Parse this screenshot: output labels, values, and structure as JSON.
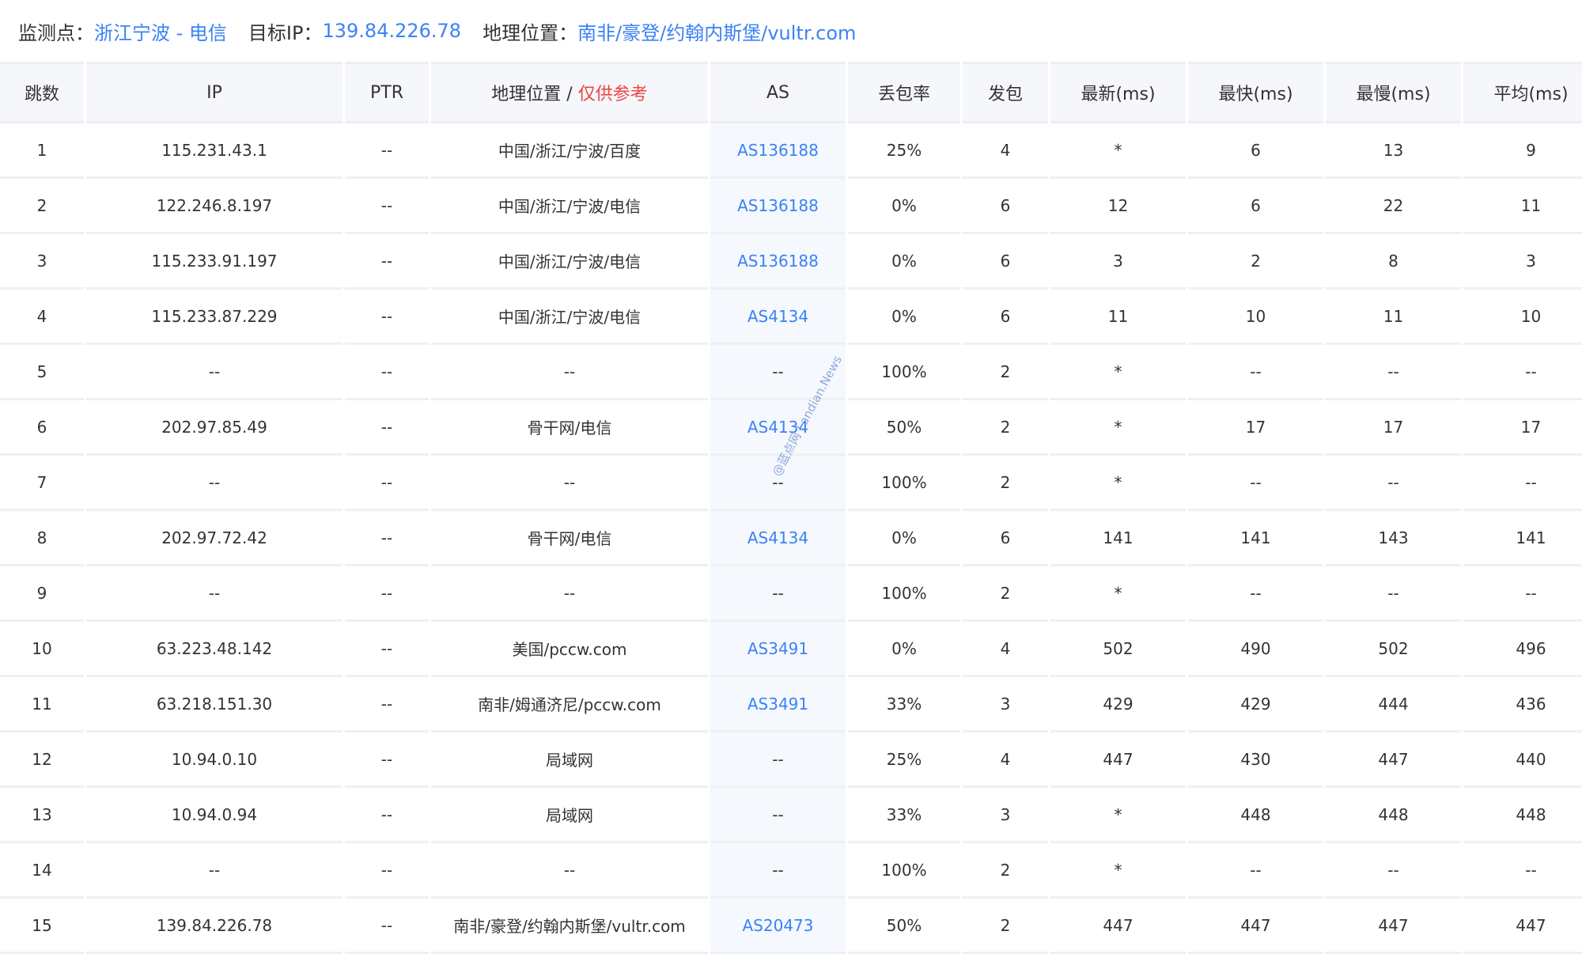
{
  "header": {
    "monitor_label": "监测点：",
    "monitor_value": "浙江宁波 - 电信",
    "target_label": "目标IP：",
    "target_value": "139.84.226.78",
    "geo_label": "地理位置：",
    "geo_value": "南非/豪登/约翰内斯堡/vultr.com"
  },
  "columns": {
    "hop": "跳数",
    "ip": "IP",
    "ptr": "PTR",
    "geo": "地理位置 / ",
    "geo_note": "仅供参考",
    "as": "AS",
    "loss": "丢包率",
    "sent": "发包",
    "last": "最新(ms)",
    "best": "最快(ms)",
    "worst": "最慢(ms)",
    "avg": "平均(ms)"
  },
  "rows": [
    {
      "hop": "1",
      "ip": "115.231.43.1",
      "ptr": "--",
      "geo": "中国/浙江/宁波/百度",
      "as": "AS136188",
      "loss": "25%",
      "sent": "4",
      "last": "*",
      "best": "6",
      "worst": "13",
      "avg": "9"
    },
    {
      "hop": "2",
      "ip": "122.246.8.197",
      "ptr": "--",
      "geo": "中国/浙江/宁波/电信",
      "as": "AS136188",
      "loss": "0%",
      "sent": "6",
      "last": "12",
      "best": "6",
      "worst": "22",
      "avg": "11"
    },
    {
      "hop": "3",
      "ip": "115.233.91.197",
      "ptr": "--",
      "geo": "中国/浙江/宁波/电信",
      "as": "AS136188",
      "loss": "0%",
      "sent": "6",
      "last": "3",
      "best": "2",
      "worst": "8",
      "avg": "3"
    },
    {
      "hop": "4",
      "ip": "115.233.87.229",
      "ptr": "--",
      "geo": "中国/浙江/宁波/电信",
      "as": "AS4134",
      "loss": "0%",
      "sent": "6",
      "last": "11",
      "best": "10",
      "worst": "11",
      "avg": "10"
    },
    {
      "hop": "5",
      "ip": "--",
      "ptr": "--",
      "geo": "--",
      "as": "--",
      "loss": "100%",
      "sent": "2",
      "last": "*",
      "best": "--",
      "worst": "--",
      "avg": "--"
    },
    {
      "hop": "6",
      "ip": "202.97.85.49",
      "ptr": "--",
      "geo": "骨干网/电信",
      "as": "AS4134",
      "loss": "50%",
      "sent": "2",
      "last": "*",
      "best": "17",
      "worst": "17",
      "avg": "17"
    },
    {
      "hop": "7",
      "ip": "--",
      "ptr": "--",
      "geo": "--",
      "as": "--",
      "loss": "100%",
      "sent": "2",
      "last": "*",
      "best": "--",
      "worst": "--",
      "avg": "--"
    },
    {
      "hop": "8",
      "ip": "202.97.72.42",
      "ptr": "--",
      "geo": "骨干网/电信",
      "as": "AS4134",
      "loss": "0%",
      "sent": "6",
      "last": "141",
      "best": "141",
      "worst": "143",
      "avg": "141"
    },
    {
      "hop": "9",
      "ip": "--",
      "ptr": "--",
      "geo": "--",
      "as": "--",
      "loss": "100%",
      "sent": "2",
      "last": "*",
      "best": "--",
      "worst": "--",
      "avg": "--"
    },
    {
      "hop": "10",
      "ip": "63.223.48.142",
      "ptr": "--",
      "geo": "美国/pccw.com",
      "as": "AS3491",
      "loss": "0%",
      "sent": "4",
      "last": "502",
      "best": "490",
      "worst": "502",
      "avg": "496"
    },
    {
      "hop": "11",
      "ip": "63.218.151.30",
      "ptr": "--",
      "geo": "南非/姆通济尼/pccw.com",
      "as": "AS3491",
      "loss": "33%",
      "sent": "3",
      "last": "429",
      "best": "429",
      "worst": "444",
      "avg": "436"
    },
    {
      "hop": "12",
      "ip": "10.94.0.10",
      "ptr": "--",
      "geo": "局域网",
      "as": "--",
      "loss": "25%",
      "sent": "4",
      "last": "447",
      "best": "430",
      "worst": "447",
      "avg": "440"
    },
    {
      "hop": "13",
      "ip": "10.94.0.94",
      "ptr": "--",
      "geo": "局域网",
      "as": "--",
      "loss": "33%",
      "sent": "3",
      "last": "*",
      "best": "448",
      "worst": "448",
      "avg": "448"
    },
    {
      "hop": "14",
      "ip": "--",
      "ptr": "--",
      "geo": "--",
      "as": "--",
      "loss": "100%",
      "sent": "2",
      "last": "*",
      "best": "--",
      "worst": "--",
      "avg": "--"
    },
    {
      "hop": "15",
      "ip": "139.84.226.78",
      "ptr": "--",
      "geo": "南非/豪登/约翰内斯堡/vultr.com",
      "as": "AS20473",
      "loss": "50%",
      "sent": "2",
      "last": "447",
      "best": "447",
      "worst": "447",
      "avg": "447"
    }
  ],
  "watermark": "@蓝点网 Landian.News",
  "colors": {
    "link": "#3b82f6",
    "warn": "#ef4444",
    "header_bg": "#f5f7fa"
  }
}
